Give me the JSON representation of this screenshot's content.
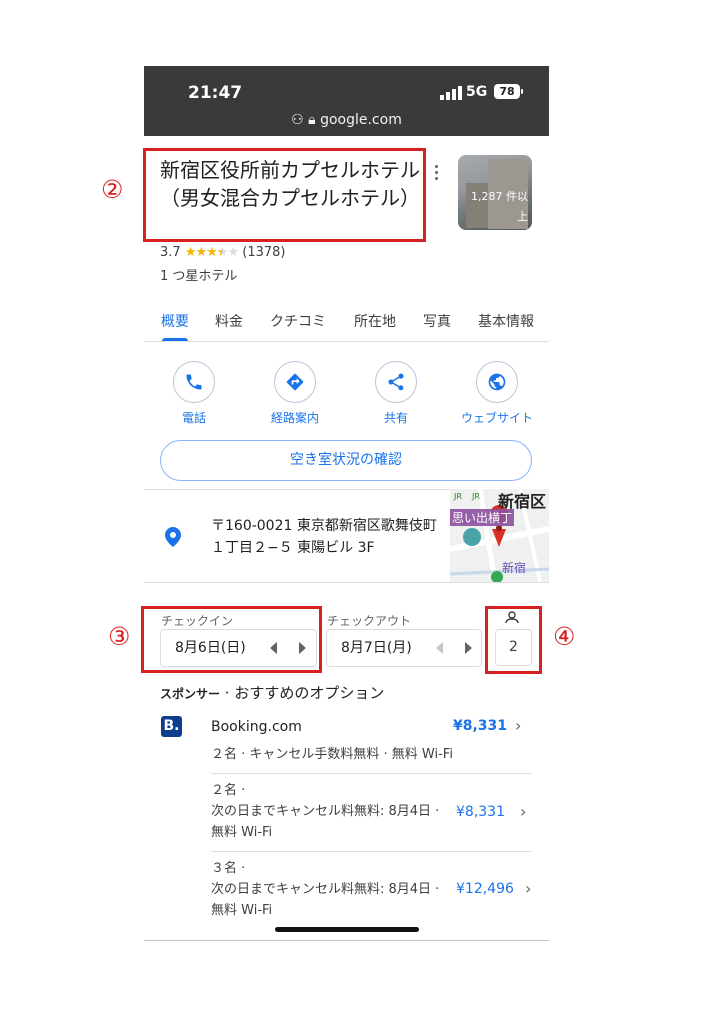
{
  "status_bar": {
    "time": "21:47",
    "network": "5G",
    "battery": "78",
    "url": "google.com"
  },
  "annotations": {
    "n2": "②",
    "n3": "③",
    "n4": "④",
    "color": "#d92020"
  },
  "hotel": {
    "name": "新宿区役所前カプセルホテル（男女混合カプセルホテル）",
    "rating": "3.7",
    "stars": 3.5,
    "review_count": "(1378)",
    "class": "1 つ星ホテル",
    "photo_count_line1": "1,287 件以",
    "photo_count_line2": "上"
  },
  "tabs": [
    {
      "label": "概要",
      "active": true
    },
    {
      "label": "料金"
    },
    {
      "label": "クチコミ"
    },
    {
      "label": "所在地"
    },
    {
      "label": "写真"
    },
    {
      "label": "基本情報"
    }
  ],
  "actions": [
    {
      "label": "電話",
      "icon": "phone-icon"
    },
    {
      "label": "経路案内",
      "icon": "directions-icon"
    },
    {
      "label": "共有",
      "icon": "share-icon"
    },
    {
      "label": "ウェブサイト",
      "icon": "globe-icon"
    }
  ],
  "availability_button": "空き室状況の確認",
  "address": {
    "line1": "〒160-0021 東京都新宿区歌舞伎町",
    "line2": "１丁目２−５ 東陽ビル 3F"
  },
  "map": {
    "label_main": "新宿区",
    "label_store": "思い出横丁",
    "label_station": "新宿"
  },
  "booking": {
    "checkin_label": "チェックイン",
    "checkin_value": "8月6日(日)",
    "checkout_label": "チェックアウト",
    "checkout_value": "8月7日(月)",
    "guests": "2"
  },
  "sponsored": {
    "prefix": "スポンサー",
    "title": " · おすすめのオプション",
    "provider_logo": "B.",
    "provider": "Booking.com",
    "main_price": "¥8,331",
    "main_details": "２名 · キャンセル手数料無料 · 無料 Wi-Fi",
    "offers": [
      {
        "line1": "２名 ·",
        "line2": "次の日までキャンセル料無料: 8月4日 ·",
        "line3": "無料 Wi-Fi",
        "price": "¥8,331"
      },
      {
        "line1": "３名 ·",
        "line2": "次の日までキャンセル料無料: 8月4日 ·",
        "line3": "無料 Wi-Fi",
        "price": "¥12,496"
      }
    ]
  },
  "colors": {
    "accent": "#1a73e8",
    "annotation_red": "#d92020",
    "status_bar": "#3a3a3a",
    "star": "#f4b400",
    "booking_brand": "#0f3e8c"
  }
}
